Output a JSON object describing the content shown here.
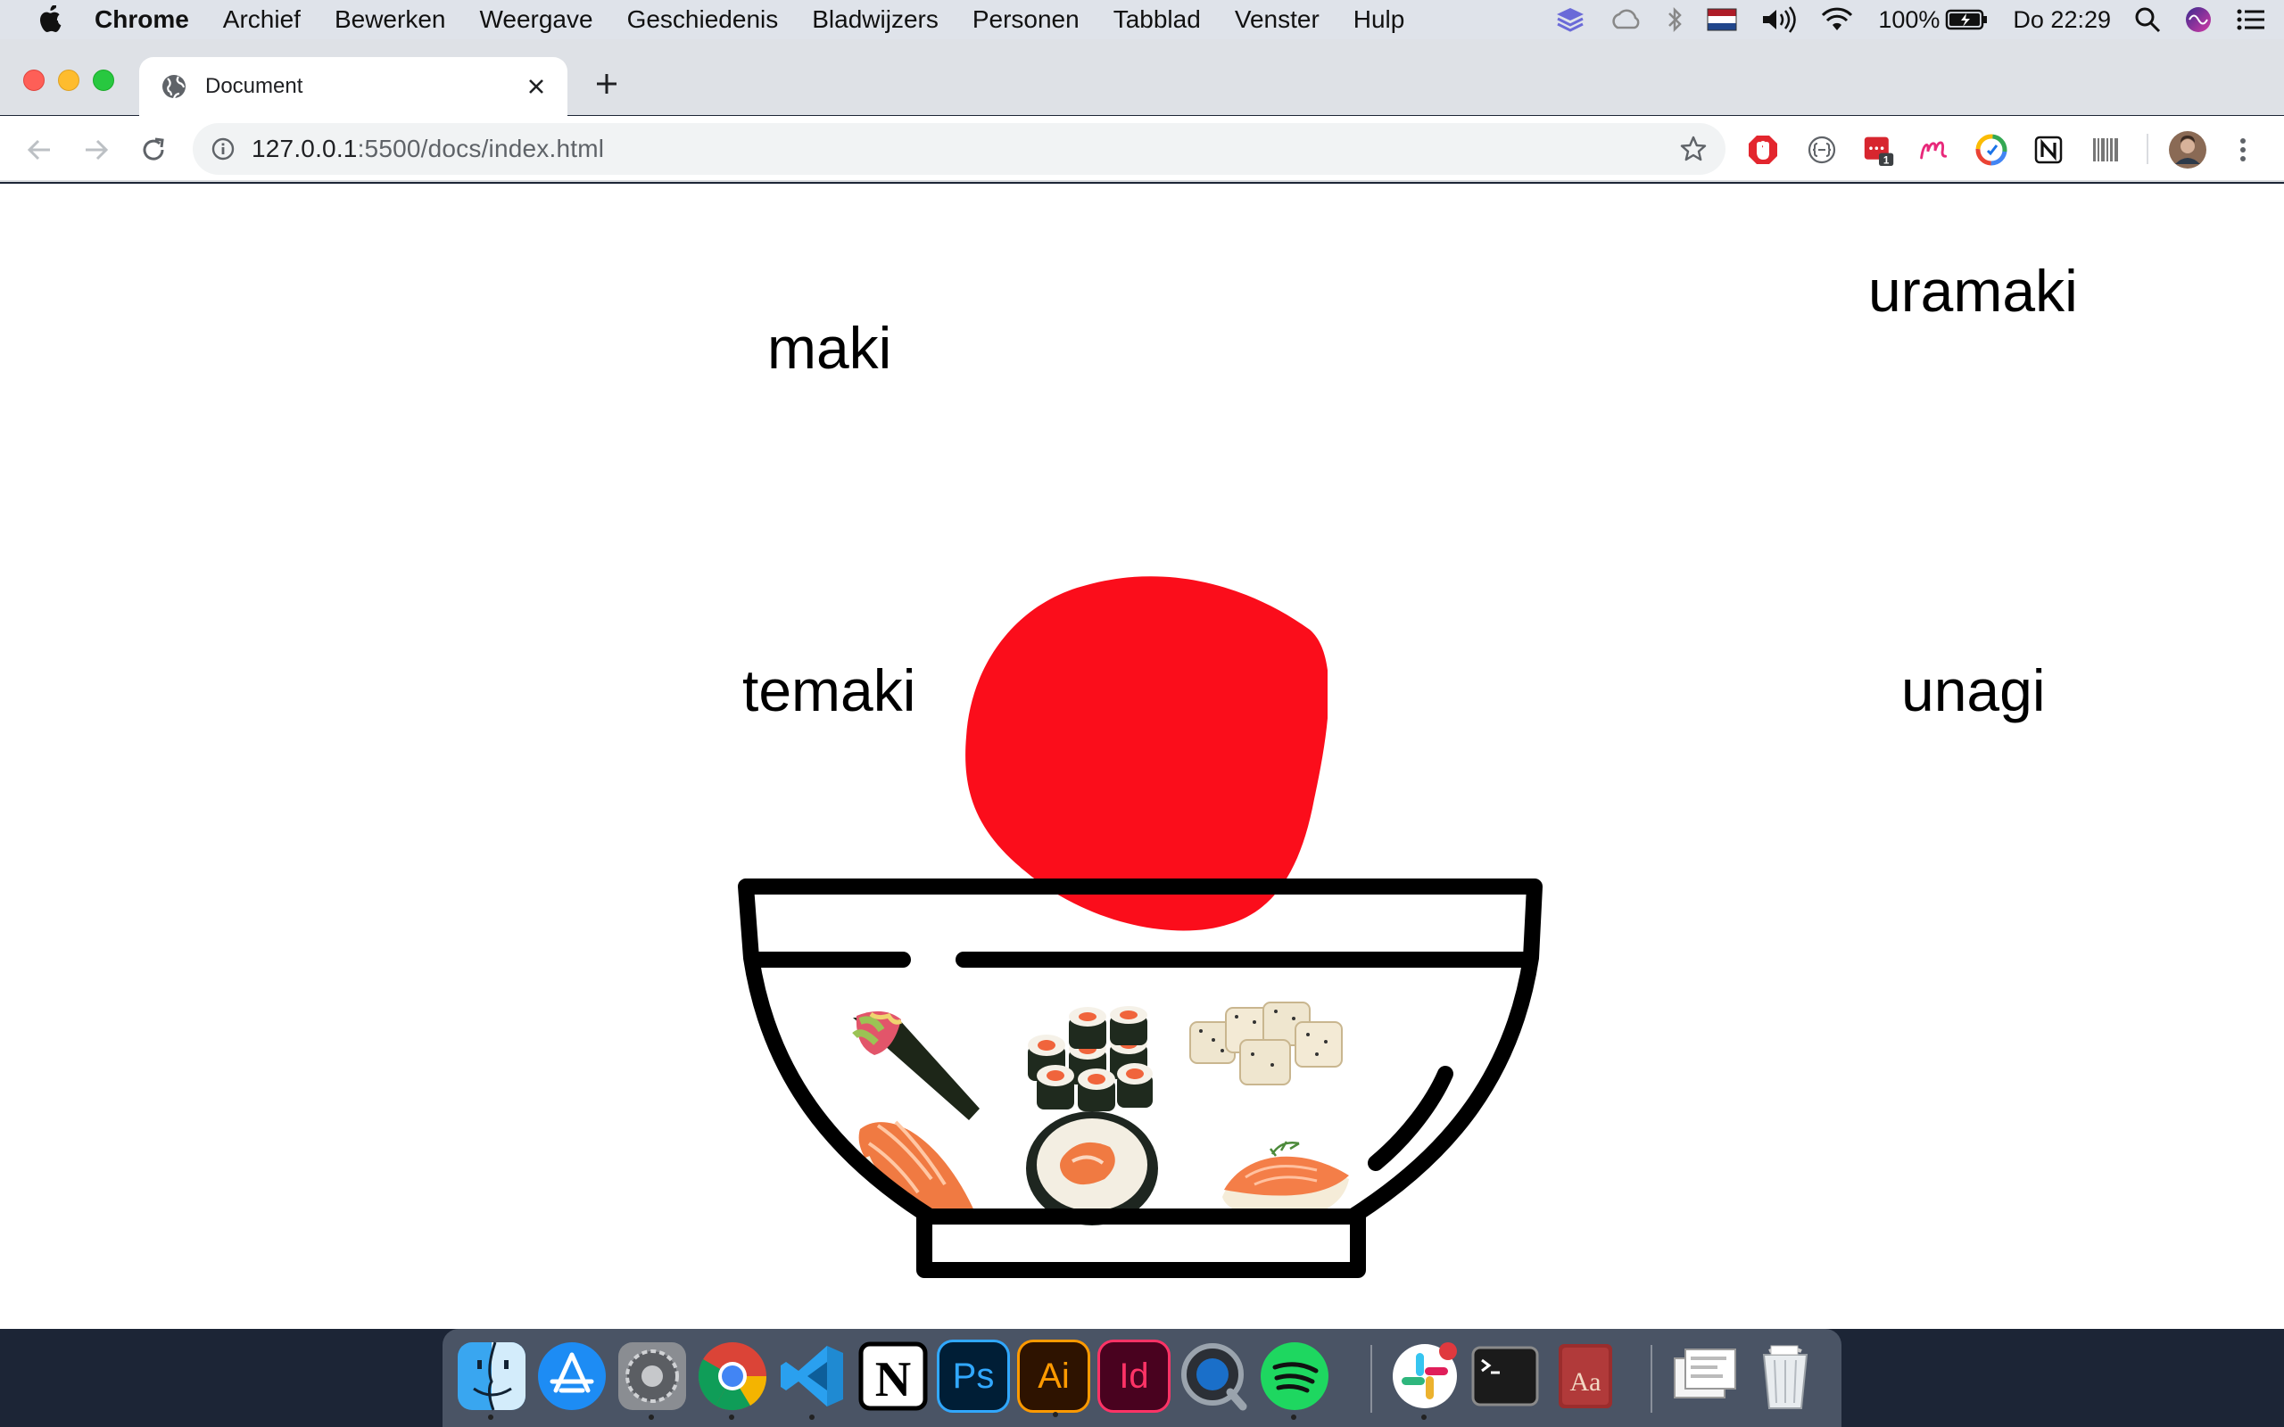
{
  "menubar": {
    "app_name": "Chrome",
    "items": [
      "Archief",
      "Bewerken",
      "Weergave",
      "Geschiedenis",
      "Bladwijzers",
      "Personen",
      "Tabblad",
      "Venster",
      "Hulp"
    ],
    "battery": "100%",
    "clock": "Do 22:29"
  },
  "browser": {
    "tab_title": "Document",
    "url_host": "127.0.0.1",
    "url_rest": ":5500/docs/index.html",
    "extension_badge": "1"
  },
  "page": {
    "words": {
      "maki": "maki",
      "uramaki": "uramaki",
      "temaki": "temaki",
      "unagi": "unagi"
    },
    "colors": {
      "blob": "#fb0d1b",
      "bowl": "#000000",
      "background": "#ffffff"
    },
    "bowl_items": [
      "temaki",
      "maki",
      "uramaki",
      "nigiri",
      "futomaki",
      "nigiri-dill"
    ]
  },
  "dock": {
    "apps": [
      "finder",
      "app-store",
      "system-preferences",
      "chrome",
      "vscode",
      "notion",
      "photoshop",
      "illustrator",
      "indesign",
      "quicktime",
      "spotify",
      "slack",
      "terminal",
      "dictionary",
      "preview",
      "trash"
    ],
    "labels": {
      "photoshop": "Ps",
      "illustrator": "Ai",
      "indesign": "Id",
      "notion": "N",
      "dictionary": "Aa"
    }
  }
}
